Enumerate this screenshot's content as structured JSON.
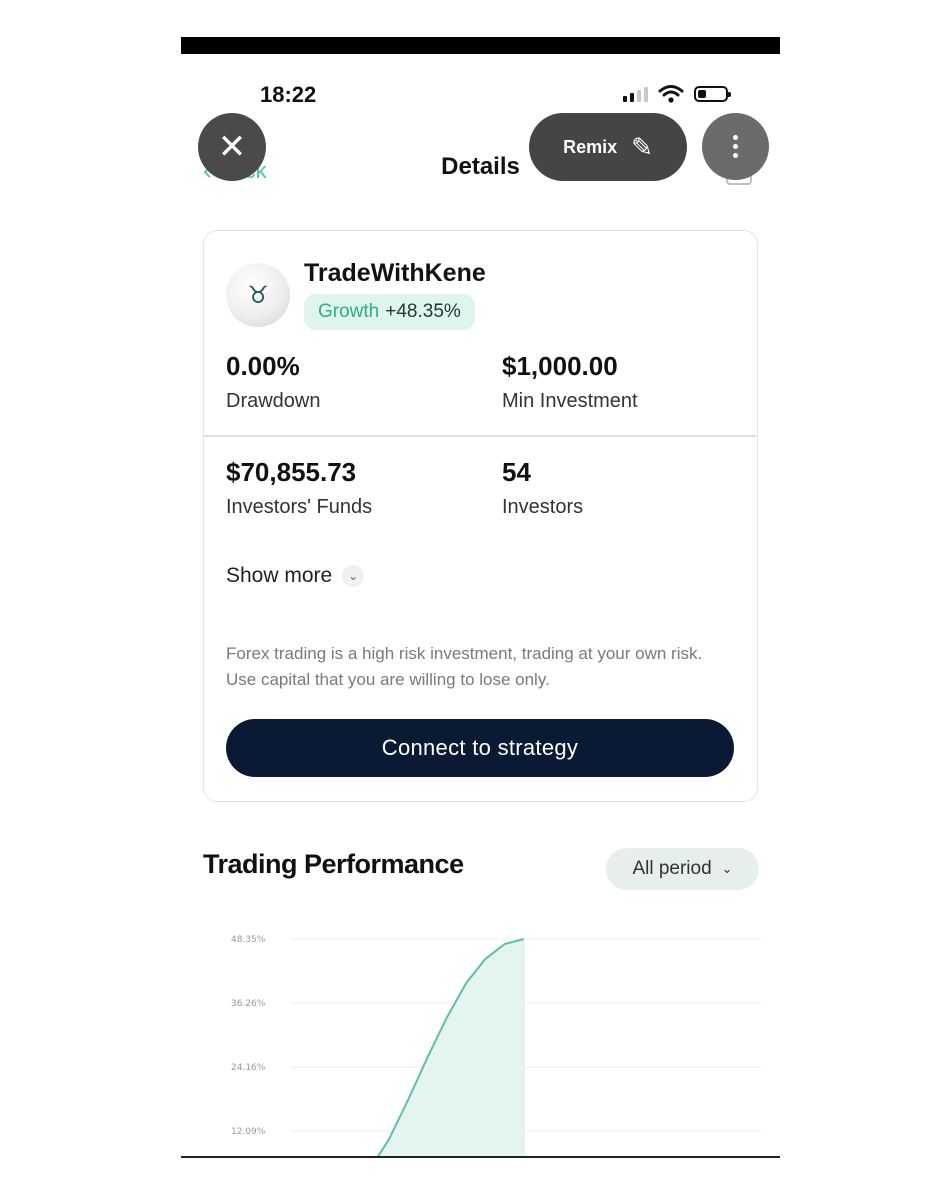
{
  "status_bar": {
    "time": "18:22"
  },
  "overlay": {
    "remix_label": "Remix"
  },
  "nav": {
    "back_label": "Back",
    "title": "Details"
  },
  "trader": {
    "name": "TradeWithKene",
    "growth_label": "Growth",
    "growth_value": "+48.35%"
  },
  "stats": [
    {
      "value": "0.00%",
      "label": "Drawdown"
    },
    {
      "value": "$1,000.00",
      "label": "Min Investment"
    },
    {
      "value": "$70,855.73",
      "label": "Investors' Funds"
    },
    {
      "value": "54",
      "label": "Investors"
    }
  ],
  "show_more_label": "Show more",
  "disclaimer": "Forex trading is a high risk investment, trading at your own risk. Use capital that you are willing to lose only.",
  "cta_label": "Connect to strategy",
  "performance": {
    "title": "Trading Performance",
    "period_label": "All period"
  },
  "chart_data": {
    "type": "area",
    "y_ticks": [
      "48.35%",
      "36.26%",
      "24.16%",
      "12.09%"
    ],
    "y_tick_values": [
      48.35,
      36.26,
      24.16,
      12.09
    ],
    "ylim": [
      0,
      48.35
    ],
    "x": [
      0,
      1,
      2,
      3,
      4,
      5,
      6,
      7,
      8,
      9,
      10
    ],
    "values": [
      0,
      1.2,
      4.8,
      10.5,
      18.0,
      26.0,
      33.5,
      40.0,
      44.6,
      47.4,
      48.35
    ],
    "color": "#5fbfa8",
    "fill": "#e4f4ef"
  }
}
